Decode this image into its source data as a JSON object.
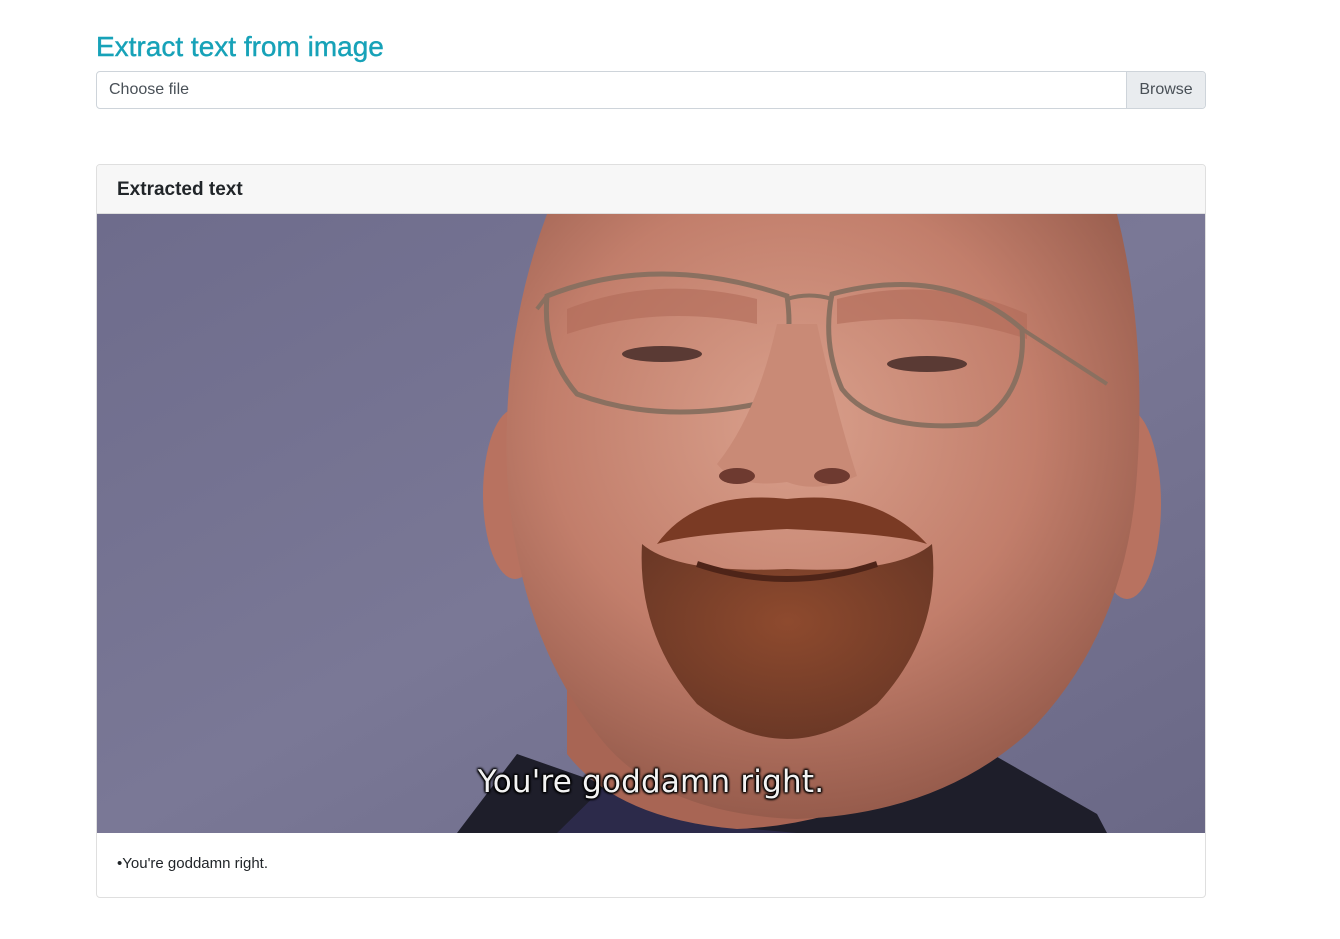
{
  "page": {
    "title": "Extract text from image"
  },
  "upload": {
    "placeholder": "Choose file",
    "browse_label": "Browse"
  },
  "result_card": {
    "header": "Extracted text",
    "image_caption": "You're goddamn right.",
    "extracted_text": "•You're goddamn right."
  },
  "colors": {
    "accent": "#17a2b8",
    "card_header_bg": "#f7f7f7",
    "browse_bg": "#e9ecef",
    "input_border": "#ced4da"
  }
}
